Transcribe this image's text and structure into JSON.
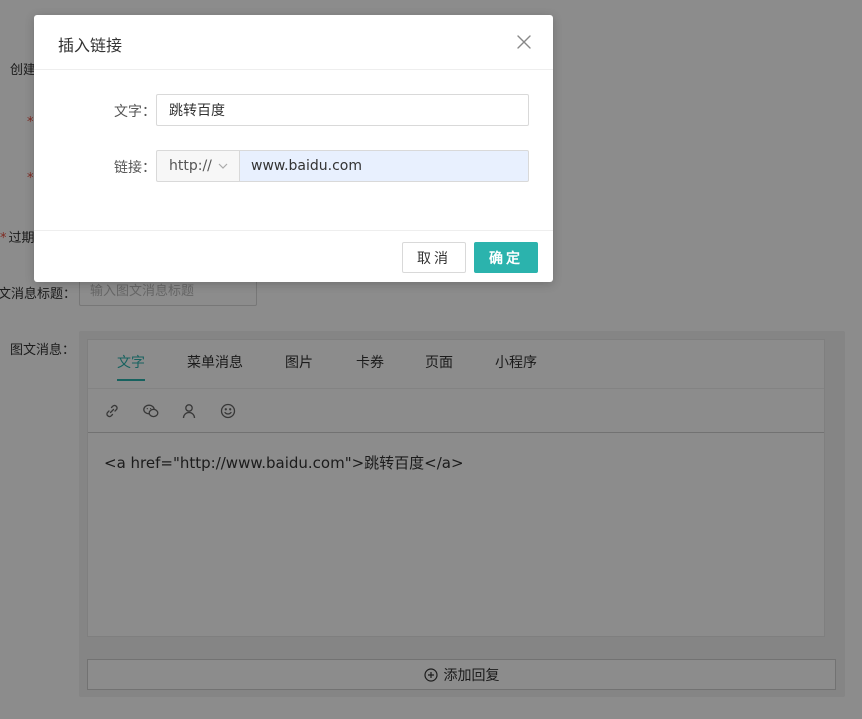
{
  "form": {
    "created_label_partial": "创建",
    "expire_label_partial": "过期",
    "news_title_label_partial": "文消息标题：",
    "news_title_placeholder": "输入图文消息标题",
    "news_label": "图文消息："
  },
  "editor": {
    "tabs": [
      "文字",
      "菜单消息",
      "图片",
      "卡券",
      "页面",
      "小程序"
    ],
    "active_tab": "文字",
    "toolbar_icons": [
      "link-icon",
      "wechat-icon",
      "user-icon",
      "emoji-icon"
    ],
    "content": "<a href=\"http://www.baidu.com\">跳转百度</a>",
    "add_reply_label": "添加回复"
  },
  "modal": {
    "title": "插入链接",
    "text_label": "文字：",
    "text_value": "跳转百度",
    "link_label": "链接：",
    "protocol": "http://",
    "url_value": "www.baidu.com",
    "cancel_label": "取消",
    "ok_label": "确定"
  },
  "colors": {
    "accent": "#2bb3ad",
    "required": "#e74c3c",
    "autofill_bg": "#e8f0fe"
  }
}
